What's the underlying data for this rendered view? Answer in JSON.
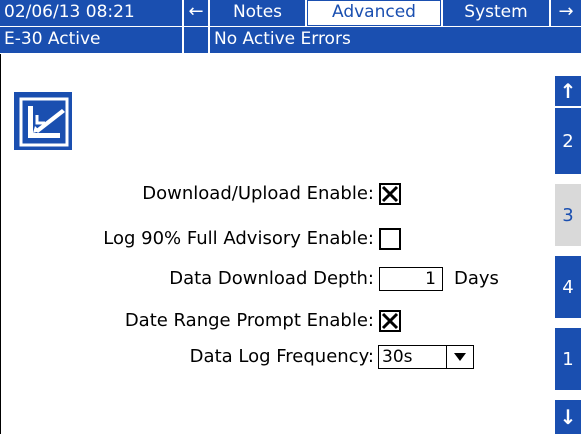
{
  "header": {
    "datetime": "02/06/13 08:21",
    "left_arrow": "←",
    "tabs": [
      {
        "label": "Notes",
        "active": false
      },
      {
        "label": "Advanced",
        "active": true
      },
      {
        "label": "System",
        "active": false
      }
    ],
    "right_arrow": "→"
  },
  "status": {
    "active": "E-30 Active",
    "errors": "No Active Errors"
  },
  "screen_icon": "edit-setup-icon",
  "sidebar": {
    "up_arrow": "↑",
    "pages": [
      {
        "label": "2",
        "active": false
      },
      {
        "label": "3",
        "active": true
      },
      {
        "label": "4",
        "active": false
      },
      {
        "label": "1",
        "active": false
      }
    ],
    "down_arrow": "↓"
  },
  "form": {
    "download_upload_label": "Download/Upload Enable:",
    "download_upload_checked": true,
    "log_advisory_label": "Log 90% Full Advisory Enable:",
    "log_advisory_checked": false,
    "depth_label": "Data Download Depth:",
    "depth_value": "1",
    "depth_unit": "Days",
    "date_range_label": "Date Range Prompt Enable:",
    "date_range_checked": true,
    "frequency_label": "Data Log Frequency:",
    "frequency_value": "30s"
  },
  "colors": {
    "accent": "#1a4fb0",
    "active_side": "#d9d9d9",
    "background": "#ffffff"
  }
}
